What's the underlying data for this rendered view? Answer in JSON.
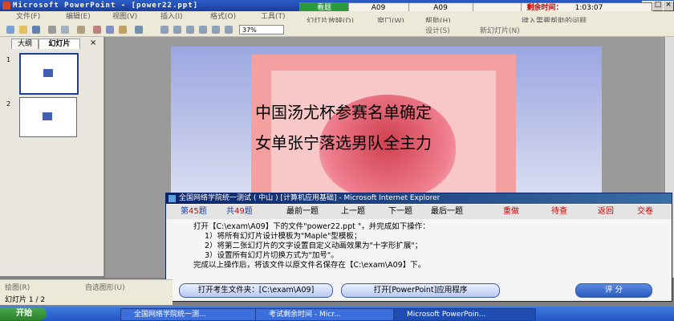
{
  "window": {
    "title": "Microsoft PowerPoint - [power22.ppt]"
  },
  "exam_bar": {
    "view_label": "看题",
    "field1": "A09",
    "field2": "A09",
    "time_label": "剩余时间：",
    "time_value": "1:03:07"
  },
  "menu": [
    "文件(F)",
    "编辑(E)",
    "视图(V)",
    "插入(I)",
    "格式(O)",
    "工具(T)",
    "幻灯片放映(D)",
    "窗口(W)",
    "帮助(H)"
  ],
  "help_box": "键入需要帮助的问题",
  "toolbar": {
    "zoom": "37%",
    "design_label": "设计(S)",
    "new_slide_label": "新幻灯片(N)"
  },
  "left_panel": {
    "tab_outline": "大纲",
    "tab_slides": "幻灯片",
    "slides": [
      "1",
      "2"
    ]
  },
  "slide": {
    "line1": "中国汤尤杯参赛名单确定",
    "line2": "女单张宁落选男队全主力"
  },
  "dialog": {
    "title": "全国网络学院统一测试 ( 中山 ) [计算机应用基础] - Microsoft Internet Explorer",
    "current_q_pre": "第",
    "current_q": "45",
    "current_q_post": "题",
    "total_pre": "共",
    "total": "49",
    "total_post": "题",
    "nav": [
      "最前一题",
      "上一题",
      "下一题",
      "最后一题"
    ],
    "redo": "重做",
    "review": "待查",
    "back": "返回",
    "submit": "交卷",
    "body_line1": "打开【C:\\exam\\A09】下的文件\"power22.ppt \"，并完成如下操作：",
    "body_line2": "1）将所有幻灯片设计模板为\"Maple\"型模板；",
    "body_line3": "2）将第二张幻灯片的文字设置自定义动画效果为\"十字形扩展\"；",
    "body_line4": "3）设置所有幻灯片切换方式为\"加号\"。",
    "body_line5": "完成以上操作后，将该文件以原文件名保存在【C:\\exam\\A09】下。",
    "btn_open_folder": "打开考生文件夹：[C:\\exam\\A09]",
    "btn_open_app": "打开[PowerPoint]应用程序",
    "btn_grade": "评 分"
  },
  "draw_toolbar": {
    "draw": "绘图(R)",
    "autoshapes": "自选图形(U)"
  },
  "status": {
    "slide": "幻灯片 1 / 2"
  },
  "taskbar": {
    "start": "开始",
    "tasks": [
      "全国网络学院统一测...",
      "考试剩余时间 - Micr...",
      "Microsoft PowerPoin..."
    ]
  },
  "colors": {
    "accent_red": "#cc0000",
    "title_blue": "#1c3f9a",
    "slide_pink": "#f4a0a0"
  }
}
